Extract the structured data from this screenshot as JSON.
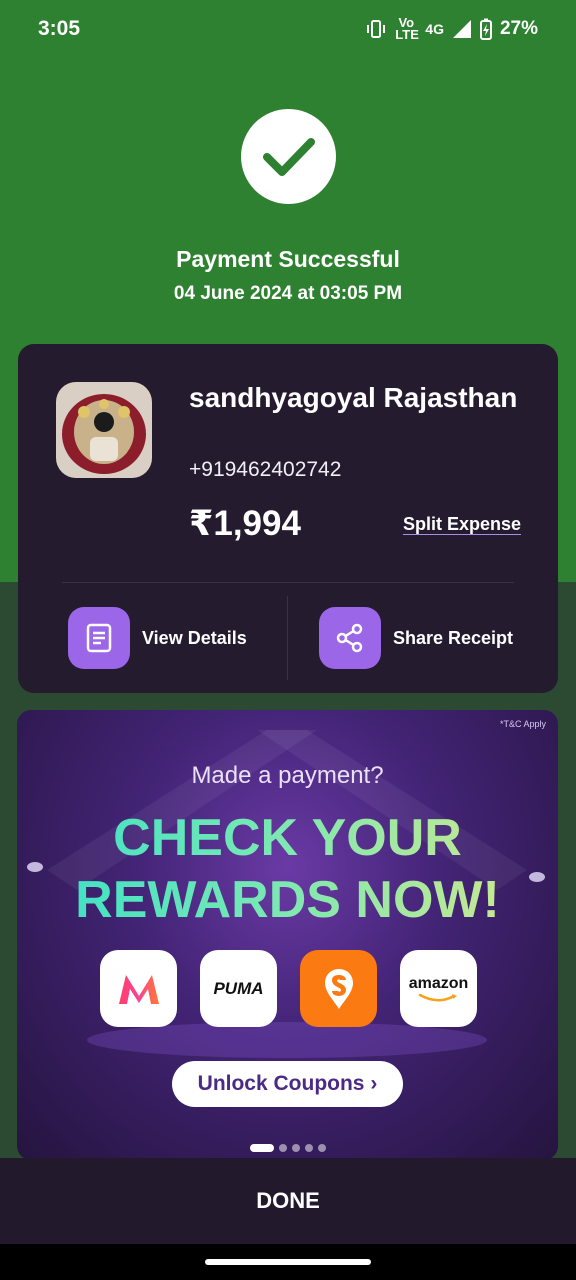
{
  "status_bar": {
    "time": "3:05",
    "network_label": "Vo LTE",
    "network_type": "4G",
    "battery": "27%"
  },
  "payment": {
    "title": "Payment Successful",
    "datetime": "04 June 2024 at 03:05 PM",
    "icon": "check-icon"
  },
  "payee": {
    "name": "sandhyagoyal Rajasthan",
    "phone": "+919462402742",
    "amount": "₹1,994",
    "split_label": "Split Expense"
  },
  "actions": {
    "view_details": "View Details",
    "share_receipt": "Share Receipt"
  },
  "banner": {
    "tc": "*T&C Apply",
    "subtitle": "Made a payment?",
    "headline_line1": "CHECK YOUR",
    "headline_line2": "REWARDS NOW!",
    "brands": [
      "Myntra",
      "PUMA",
      "Swiggy",
      "amazon"
    ],
    "puma_text": "PUMA",
    "amazon_text": "amazon",
    "button": "Unlock Coupons ›",
    "slide_count": 5,
    "active_slide": 1
  },
  "done_label": "DONE",
  "colors": {
    "success_green": "#2e8130",
    "card_bg": "#241b2f",
    "accent_purple": "#9b66e8"
  }
}
